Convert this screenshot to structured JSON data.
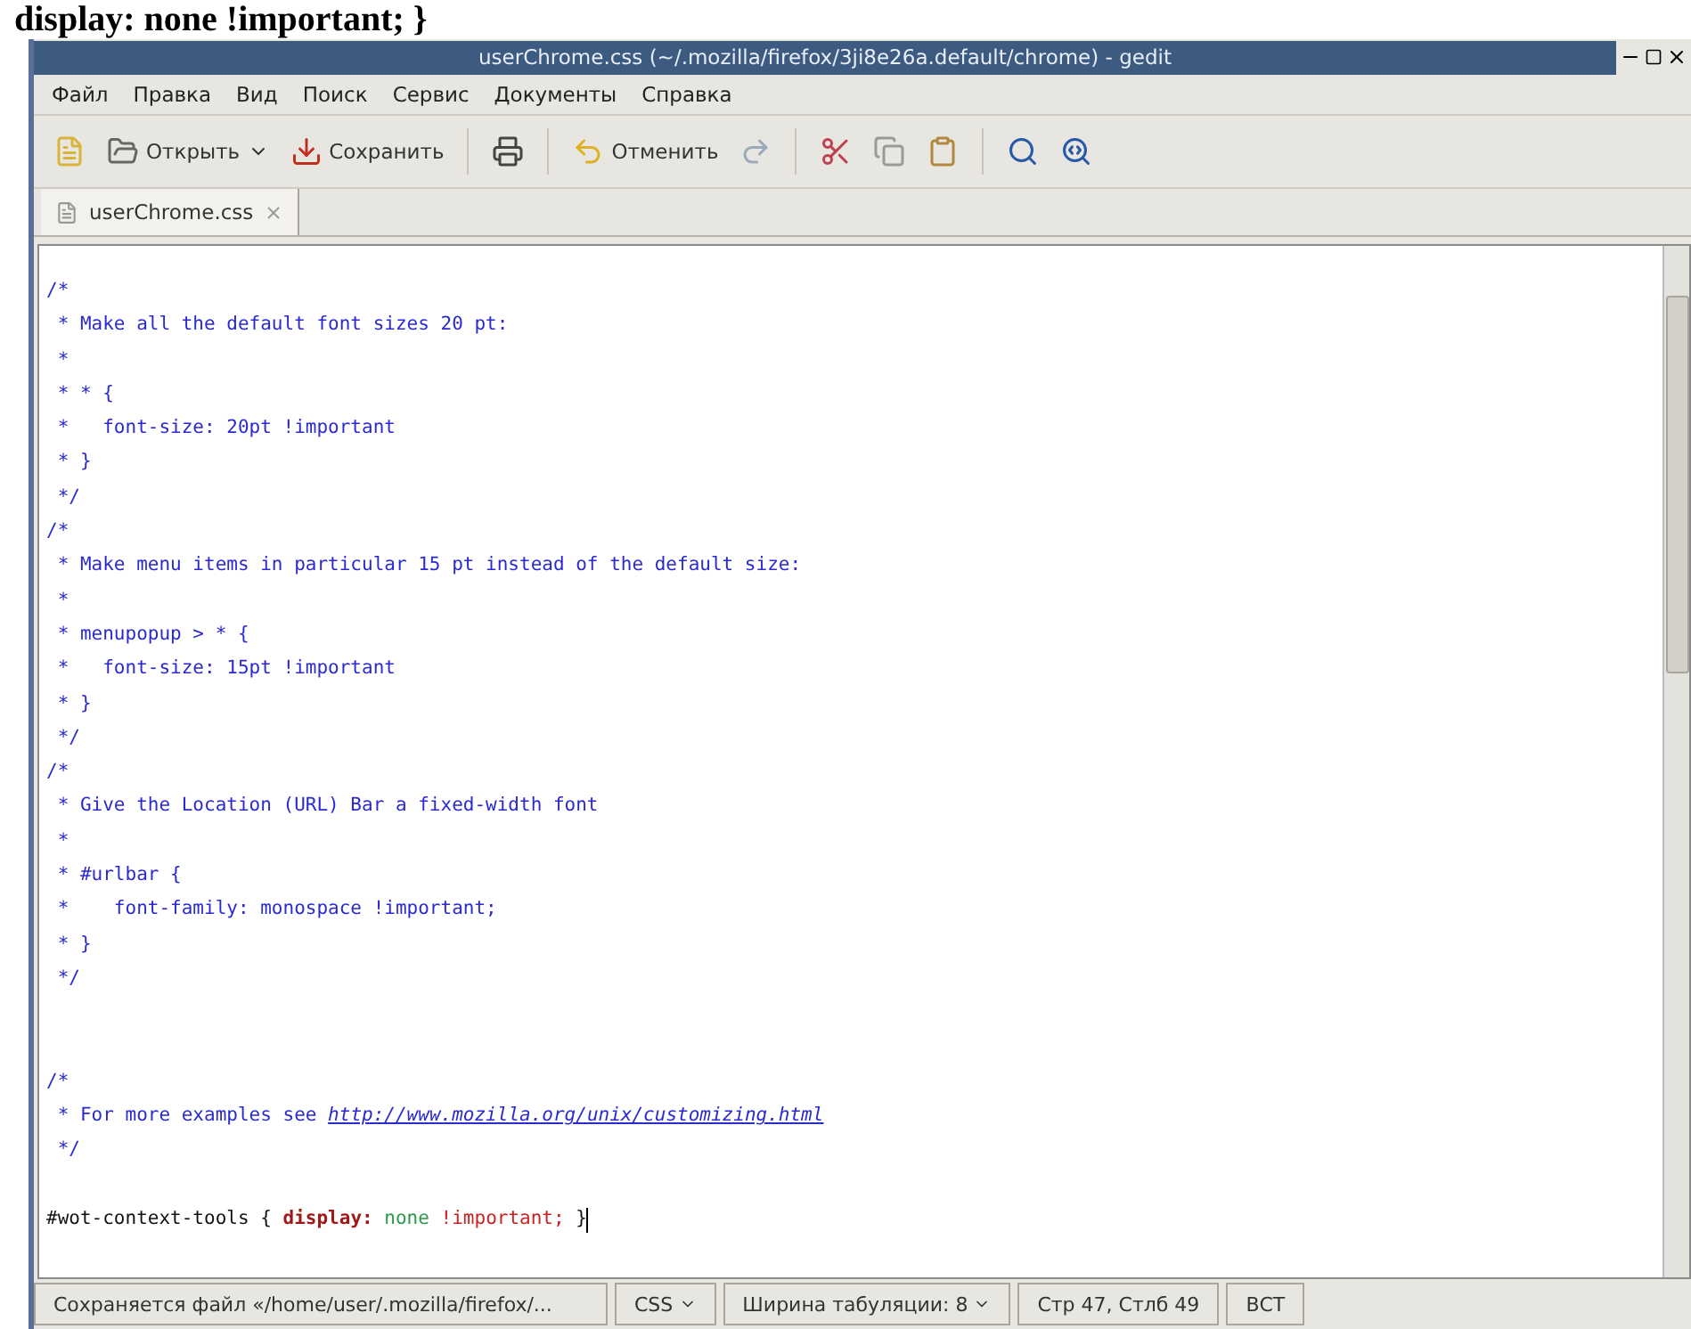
{
  "background_text": "display: none !important; }",
  "window": {
    "title": "userChrome.css (~/.mozilla/firefox/3ji8e26a.default/chrome) - gedit"
  },
  "menu": [
    "Файл",
    "Правка",
    "Вид",
    "Поиск",
    "Сервис",
    "Документы",
    "Справка"
  ],
  "toolbar": [
    {
      "kind": "icon"
    },
    {
      "kind": "dropdown",
      "label": "Открыть"
    },
    {
      "kind": "button",
      "label": "Сохранить"
    },
    {
      "kind": "separator"
    },
    {
      "kind": "icon"
    },
    {
      "kind": "separator"
    },
    {
      "kind": "button",
      "label": "Отменить"
    },
    {
      "kind": "icon"
    },
    {
      "kind": "separator"
    },
    {
      "kind": "icon"
    },
    {
      "kind": "icon"
    },
    {
      "kind": "icon"
    },
    {
      "kind": "separator"
    },
    {
      "kind": "icon"
    },
    {
      "kind": "icon"
    }
  ],
  "tabs": [
    {
      "label": "userChrome.css",
      "selected": true
    }
  ],
  "editor": {
    "lines": [
      {
        "kind": "code",
        "segments": [
          {
            "kind": "comment",
            "text": "/*"
          }
        ]
      },
      {
        "kind": "code",
        "segments": [
          {
            "kind": "comment",
            "text": " * Make all the default font sizes 20 pt:"
          }
        ]
      },
      {
        "kind": "code",
        "segments": [
          {
            "kind": "comment",
            "text": " *"
          }
        ]
      },
      {
        "kind": "code",
        "segments": [
          {
            "kind": "comment",
            "text": " * * {"
          }
        ]
      },
      {
        "kind": "code",
        "segments": [
          {
            "kind": "comment",
            "text": " *   font-size: 20pt !important"
          }
        ]
      },
      {
        "kind": "code",
        "segments": [
          {
            "kind": "comment",
            "text": " * }"
          }
        ]
      },
      {
        "kind": "code",
        "segments": [
          {
            "kind": "comment",
            "text": " */"
          }
        ]
      },
      {
        "kind": "code",
        "segments": [
          {
            "kind": "comment",
            "text": "/*"
          }
        ]
      },
      {
        "kind": "code",
        "segments": [
          {
            "kind": "comment",
            "text": " * Make menu items in particular 15 pt instead of the default size:"
          }
        ]
      },
      {
        "kind": "code",
        "segments": [
          {
            "kind": "comment",
            "text": " *"
          }
        ]
      },
      {
        "kind": "code",
        "segments": [
          {
            "kind": "comment",
            "text": " * menupopup > * {"
          }
        ]
      },
      {
        "kind": "code",
        "segments": [
          {
            "kind": "comment",
            "text": " *   font-size: 15pt !important"
          }
        ]
      },
      {
        "kind": "code",
        "segments": [
          {
            "kind": "comment",
            "text": " * }"
          }
        ]
      },
      {
        "kind": "code",
        "segments": [
          {
            "kind": "comment",
            "text": " */"
          }
        ]
      },
      {
        "kind": "code",
        "segments": [
          {
            "kind": "comment",
            "text": "/*"
          }
        ]
      },
      {
        "kind": "code",
        "segments": [
          {
            "kind": "comment",
            "text": " * Give the Location (URL) Bar a fixed-width font"
          }
        ]
      },
      {
        "kind": "code",
        "segments": [
          {
            "kind": "comment",
            "text": " *"
          }
        ]
      },
      {
        "kind": "code",
        "segments": [
          {
            "kind": "comment",
            "text": " * #urlbar {"
          }
        ]
      },
      {
        "kind": "code",
        "segments": [
          {
            "kind": "comment",
            "text": " *    font-family: monospace !important;"
          }
        ]
      },
      {
        "kind": "code",
        "segments": [
          {
            "kind": "comment",
            "text": " * }"
          }
        ]
      },
      {
        "kind": "code",
        "segments": [
          {
            "kind": "comment",
            "text": " */"
          }
        ]
      },
      {
        "kind": "blank"
      },
      {
        "kind": "blank"
      },
      {
        "kind": "code",
        "segments": [
          {
            "kind": "comment",
            "text": "/*"
          }
        ]
      },
      {
        "kind": "code",
        "segments": [
          {
            "kind": "comment",
            "text": " * For more examples see "
          },
          {
            "kind": "link",
            "text": "http://www.mozilla.org/unix/customizing.html"
          }
        ]
      },
      {
        "kind": "code",
        "segments": [
          {
            "kind": "comment",
            "text": " */"
          }
        ]
      },
      {
        "kind": "blank"
      },
      {
        "kind": "code",
        "cursor": true,
        "segments": [
          {
            "kind": "selector",
            "text": "#wot-context-tools { "
          },
          {
            "kind": "property",
            "text": "display:"
          },
          {
            "kind": "value",
            "text": " none "
          },
          {
            "kind": "important",
            "text": "!important;"
          },
          {
            "kind": "selector",
            "text": " }"
          }
        ]
      }
    ]
  },
  "status_bar": [
    {
      "kind": "text",
      "text": "Сохраняется файл «/home/user/.mozilla/firefox/..."
    },
    {
      "kind": "dropdown",
      "text": "CSS"
    },
    {
      "kind": "dropdown",
      "text": "Ширина табуляции: 8"
    },
    {
      "kind": "text",
      "text": "Стр 47, Стлб 49"
    },
    {
      "kind": "text",
      "text": "ВСТ"
    }
  ]
}
